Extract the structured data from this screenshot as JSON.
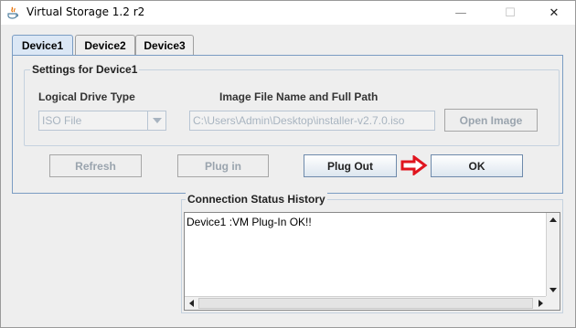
{
  "window": {
    "title": "Virtual Storage 1.2 r2",
    "controls": {
      "minimize": "—",
      "maximize": "☐",
      "close": "✕"
    }
  },
  "tabs": [
    {
      "label": "Device1",
      "selected": true
    },
    {
      "label": "Device2",
      "selected": false
    },
    {
      "label": "Device3",
      "selected": false
    }
  ],
  "settings": {
    "group_title": "Settings for Device1",
    "drive_type_label": "Logical Drive Type",
    "drive_type_value": "ISO File",
    "image_path_label": "Image File Name and Full Path",
    "image_path_value": "C:\\Users\\Admin\\Desktop\\installer-v2.7.0.iso",
    "open_image_label": "Open Image"
  },
  "buttons": {
    "refresh": "Refresh",
    "plug_in": "Plug in",
    "plug_out": "Plug Out",
    "ok": "OK"
  },
  "status": {
    "title": "Connection Status History",
    "log": "Device1 :VM Plug-In OK!!"
  },
  "colors": {
    "arrow": "#e0141e",
    "tab_active": "#dbe7f5",
    "panel_border": "#7a9cc3"
  }
}
